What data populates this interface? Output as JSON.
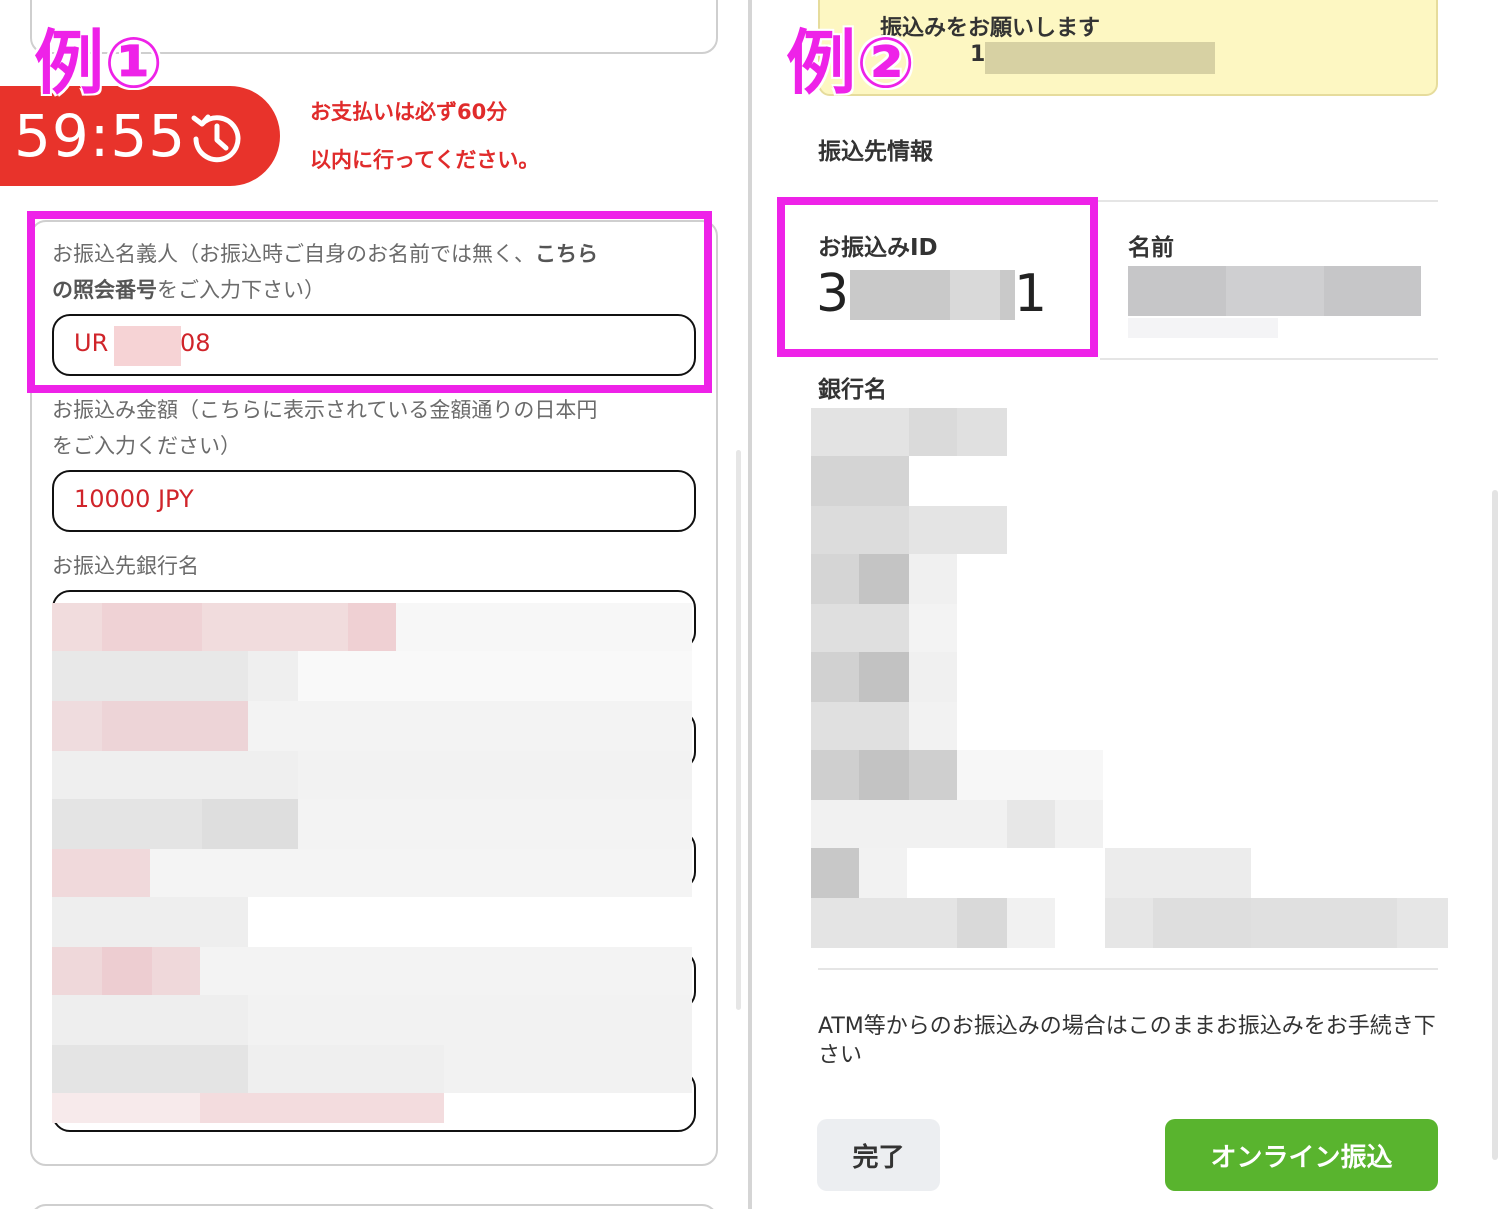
{
  "left": {
    "example_label": "例①",
    "timer": "59:55",
    "notice_line1": "お支払いは必ず60分",
    "notice_line2": "以内に行ってください。",
    "name_label_pre": "お振込名義人（お振込時ご自身のお名前では無く、",
    "name_label_bold1": "こちら",
    "name_label_bold2": "の照会番号",
    "name_label_post": "をご入力下さい）",
    "name_prefix": "UR",
    "name_suffix": "08",
    "amount_label_line1": "お振込み金額（こちらに表示されている金額通りの日本円",
    "amount_label_line2": "をご入力ください）",
    "amount_value": "10000 JPY",
    "bank_label": "お振込先銀行名"
  },
  "right": {
    "example_label": "例②",
    "banner_line": "振込みをお願いします",
    "banner_id_visible": "1",
    "section_title": "振込先情報",
    "id_label": "お振込みID",
    "id_prefix": "3",
    "id_suffix": "1",
    "name_label": "名前",
    "bank_label": "銀行名",
    "note": "ATM等からのお振込みの場合はこのままお振込みをお手続き下さい",
    "btn_done": "完了",
    "btn_online": "オンライン振込"
  },
  "colors": {
    "timer_bg": "#e8332b",
    "highlight": "#ee22e8",
    "value_red": "#d0242a",
    "online_green": "#59b42e",
    "banner_yellow": "#fdf7c2"
  },
  "icons": {
    "timer": "clock-icon"
  }
}
